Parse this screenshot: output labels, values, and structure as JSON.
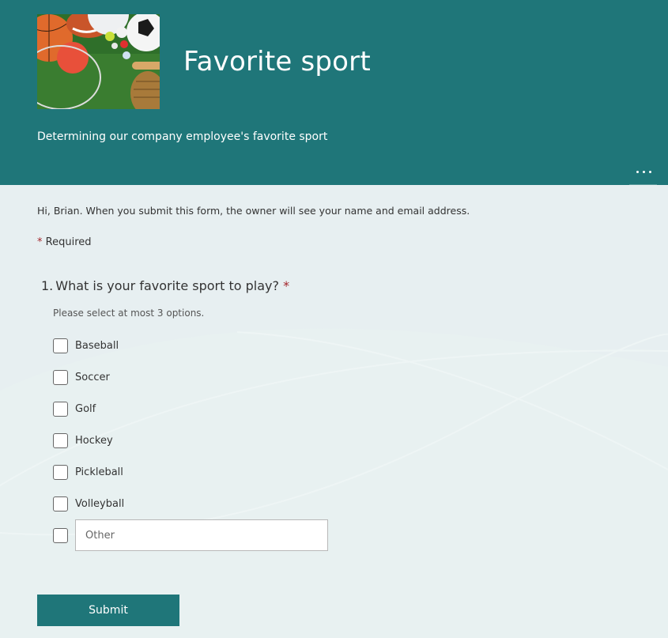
{
  "header": {
    "title": "Favorite sport",
    "subtitle": "Determining our company employee's favorite sport",
    "image_alt": "sports-equipment-on-grass",
    "more_icon": "ellipsis-icon"
  },
  "notice": "Hi, Brian. When you submit this form, the owner will see your name and email address.",
  "required_note": {
    "asterisk": "*",
    "label": "Required"
  },
  "question": {
    "number": "1.",
    "text": "What is your favorite sport to play?",
    "required_marker": "*",
    "hint": "Please select at most 3 options.",
    "options": [
      {
        "label": "Baseball",
        "checked": false
      },
      {
        "label": "Soccer",
        "checked": false
      },
      {
        "label": "Golf",
        "checked": false
      },
      {
        "label": "Hockey",
        "checked": false
      },
      {
        "label": "Pickleball",
        "checked": false
      },
      {
        "label": "Volleyball",
        "checked": false
      }
    ],
    "other": {
      "checked": false,
      "placeholder": "Other",
      "value": ""
    }
  },
  "submit_label": "Submit",
  "colors": {
    "theme": "#1f7679",
    "background": "#e8f1f1",
    "required": "#a4262c"
  }
}
